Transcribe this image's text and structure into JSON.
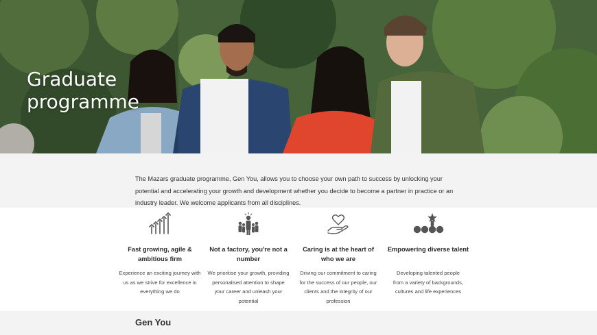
{
  "hero": {
    "title": "Graduate programme",
    "image": "four-graduates-outdoors-photo"
  },
  "intro": {
    "text": "The Mazars graduate programme, Gen You, allows you to choose your own path to success by unlocking your potential and accelerating your growth and development whether you decide to become a partner in practice or an industry leader.  We welcome applicants from all disciplines."
  },
  "features": [
    {
      "icon": "growth-chart-icon",
      "title": "Fast growing, agile & ambitious firm",
      "text": "Experience an exciting journey with us as we strive for excellence in everything we do"
    },
    {
      "icon": "person-in-crowd-icon",
      "title": "Not a factory, you're not a number",
      "text": "We prioritise your growth, providing personalised attention to shape your career and unleash your potential"
    },
    {
      "icon": "heart-in-hand-icon",
      "title": "Caring is at the heart of who we are",
      "text": "Driving our commitment to caring for the success of our people, our clients and the integrity of our profession"
    },
    {
      "icon": "diverse-people-star-icon",
      "title": "Empowering diverse talent",
      "text": "Developing talented people from a variety of backgrounds, cultures and life experiences"
    }
  ],
  "section": {
    "heading": "Gen You"
  }
}
